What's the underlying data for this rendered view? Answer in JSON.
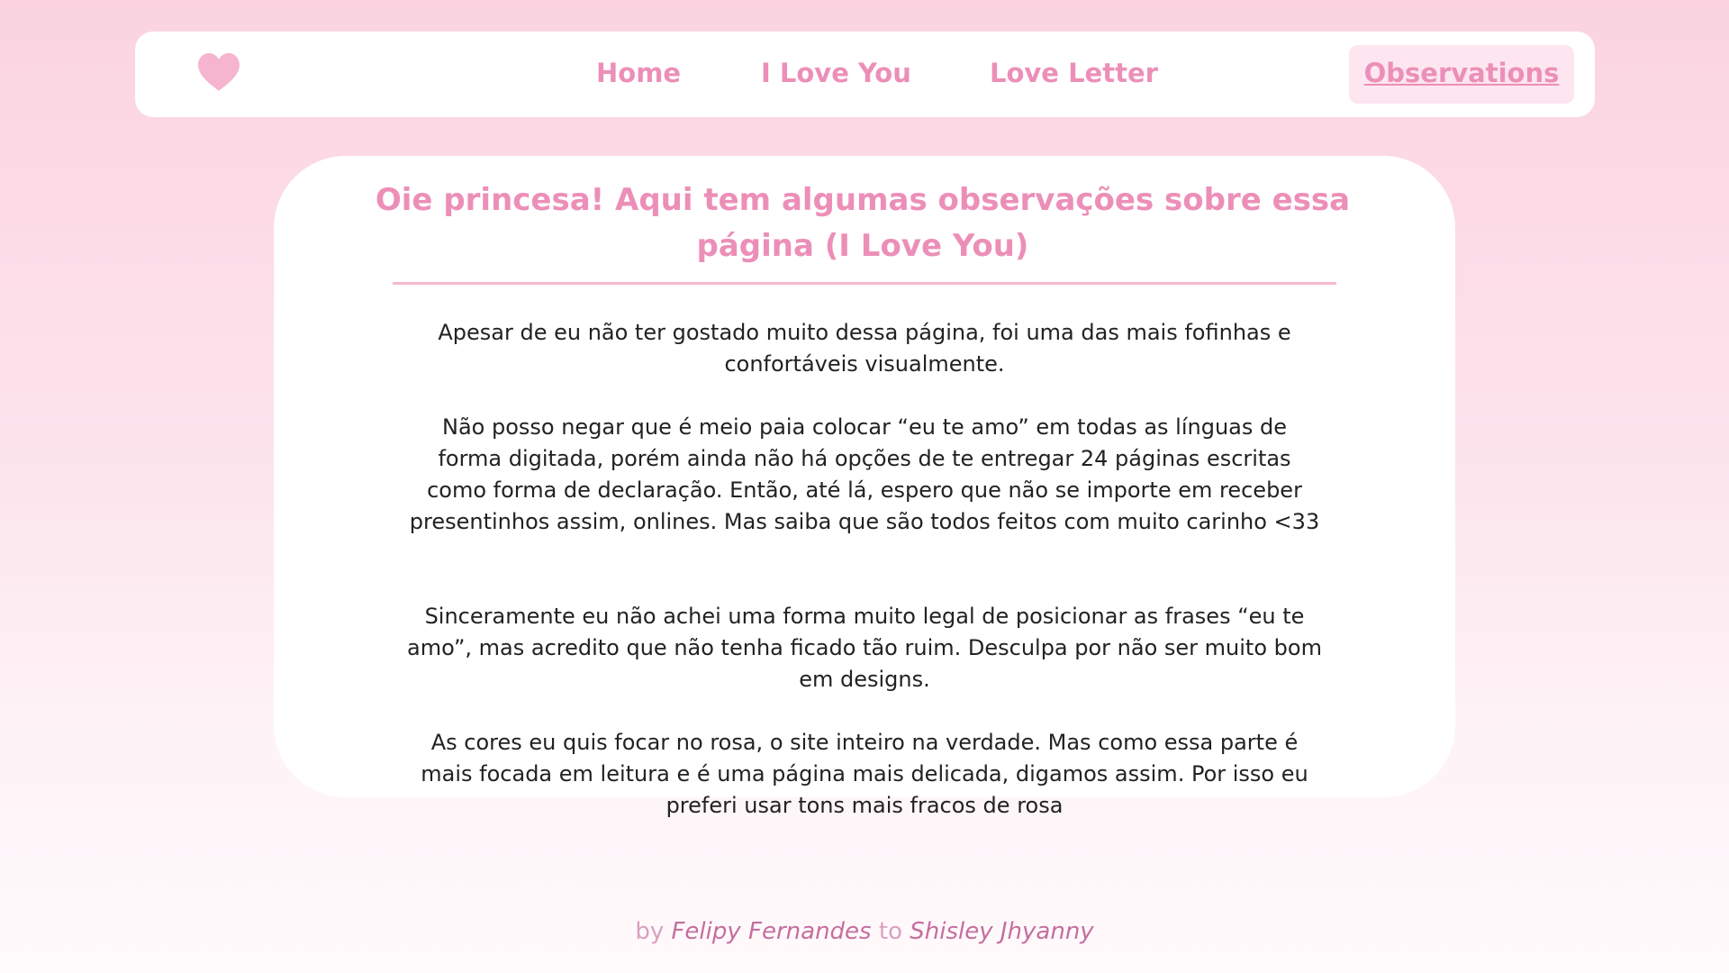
{
  "nav": {
    "logo_icon": "heart-icon",
    "items": [
      {
        "label": "Home"
      },
      {
        "label": "I Love You"
      },
      {
        "label": "Love Letter"
      },
      {
        "label": "Observations",
        "active": true
      }
    ]
  },
  "main": {
    "title": "Oie princesa! Aqui tem algumas observações sobre essa página (I Love You)",
    "paragraphs": [
      "Apesar de eu não ter gostado muito dessa página, foi uma das mais fofinhas e confortáveis visualmente.",
      "Não posso negar que é meio paia colocar “eu te amo” em todas as línguas de forma digitada, porém ainda não há opções de te entregar 24 páginas escritas como forma de declaração. Então, até lá, espero que não se importe em receber presentinhos assim, onlines. Mas saiba que são todos feitos com muito carinho <33",
      "Sinceramente eu não achei uma forma muito legal de posicionar as frases “eu te amo”, mas acredito que não tenha ficado tão ruim. Desculpa por não ser muito bom em designs.",
      "As cores eu quis focar no rosa, o site inteiro na verdade. Mas como essa parte é mais focada em leitura e é uma página mais delicada, digamos assim. Por isso eu preferi usar tons mais fracos de rosa"
    ]
  },
  "footer": {
    "by": "by",
    "author": "Felipy Fernandes",
    "to": "to",
    "recipient": "Shisley Jhyanny"
  },
  "colors": {
    "accent": "#ec8fb8",
    "active_tab_bg": "#fde6ef",
    "text": "#222222",
    "footer_name": "#c56e9f"
  }
}
